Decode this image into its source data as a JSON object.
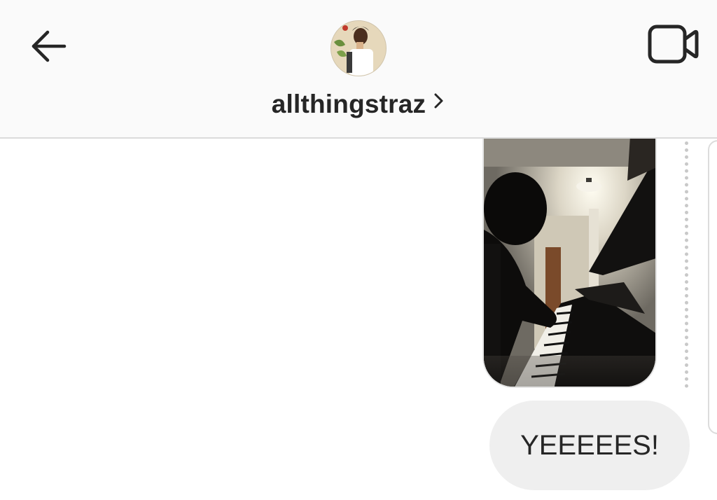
{
  "header": {
    "username": "allthingstraz",
    "back_icon": "arrow-left-icon",
    "video_icon": "video-camera-icon",
    "chevron_icon": "chevron-right-icon"
  },
  "messages": [
    {
      "type": "photo",
      "description_icon": "photo-attachment"
    },
    {
      "type": "text",
      "text": "YEEEEES!"
    }
  ],
  "colors": {
    "header_bg": "#fafafa",
    "text": "#262626",
    "bubble_bg": "#efefef"
  }
}
